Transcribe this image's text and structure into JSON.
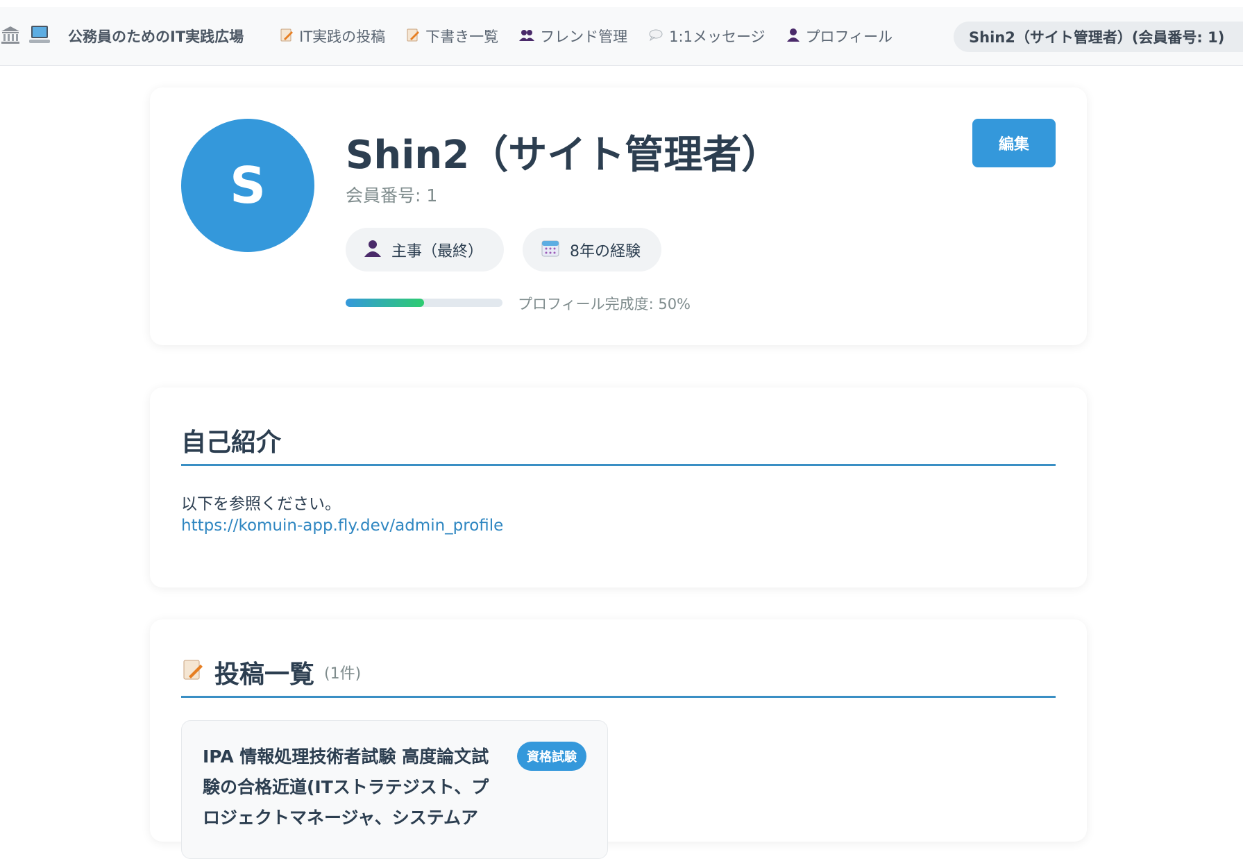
{
  "header": {
    "site_title": "公務員のためのIT実践広場",
    "nav": [
      {
        "label": "IT実践の投稿",
        "icon": "memo-icon"
      },
      {
        "label": "下書き一覧",
        "icon": "memo-icon"
      },
      {
        "label": "フレンド管理",
        "icon": "people-icon"
      },
      {
        "label": "1:1メッセージ",
        "icon": "speech-bubble-icon"
      },
      {
        "label": "プロフィール",
        "icon": "person-icon"
      }
    ],
    "user_pill": "Shin2（サイト管理者）(会員番号: 1)"
  },
  "profile": {
    "avatar_initial": "S",
    "name": "Shin2（サイト管理者）",
    "member_number": "会員番号: 1",
    "role": "主事（最終）",
    "experience": "8年の経験",
    "completion_label": "プロフィール完成度: 50%",
    "completion": 50,
    "edit_label": "編集"
  },
  "intro": {
    "title": "自己紹介",
    "text": "以下を参照ください。",
    "link": "https://komuin-app.fly.dev/admin_profile"
  },
  "posts": {
    "title": "投稿一覧",
    "count": "(1件)",
    "items": [
      {
        "title": "IPA 情報処理技術者試験 高度論文試験の合格近道(ITストラテジスト、プロジェクトマネージャ、システムア",
        "badge": "資格試験"
      }
    ]
  },
  "colors": {
    "accent": "#3498db",
    "progress_end": "#2ecc71"
  }
}
